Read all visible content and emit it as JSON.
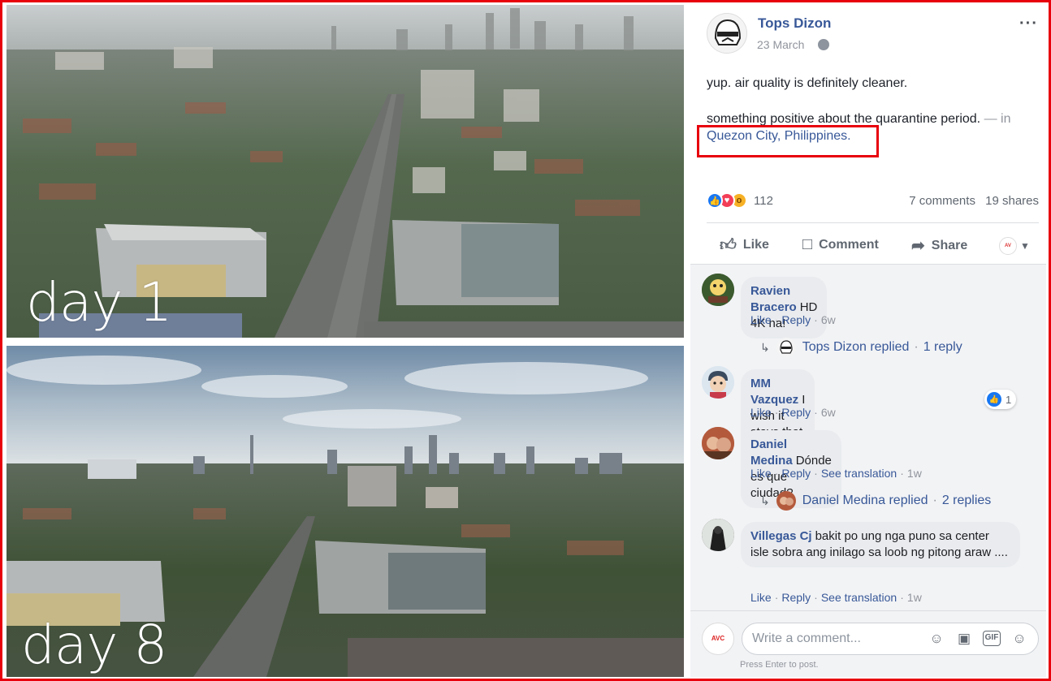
{
  "photos": {
    "top_caption": "day 1",
    "bottom_caption": "day 8"
  },
  "post": {
    "author": "Tops Dizon",
    "date": "23 March",
    "more_icon": "···",
    "line1": "yup. air quality is definitely cleaner.",
    "line2": "something positive about the quarantine period.",
    "location_prefix": "— in",
    "location": "Quezon City, Philippines.",
    "reaction_count": "112",
    "comments_count": "7 comments",
    "shares_count": "19 shares",
    "actions": {
      "like": "Like",
      "comment": "Comment",
      "share": "Share"
    }
  },
  "comments": [
    {
      "name": "Ravien Bracero",
      "text": "HD 4K na!",
      "like": "Like",
      "reply": "Reply",
      "time": "6w",
      "replied_by": "Tops Dizon replied",
      "replies": "1 reply"
    },
    {
      "name": "MM Vazquez",
      "text": "I wish it stays that way forever",
      "like": "Like",
      "reply": "Reply",
      "time": "6w",
      "like_count": "1"
    },
    {
      "name": "Daniel Medina",
      "text": "Dónde es que ciudad?",
      "like": "Like",
      "reply": "Reply",
      "translate": "See translation",
      "time": "1w",
      "replied_by": "Daniel Medina replied",
      "replies": "2 replies"
    },
    {
      "name": "Villegas Cj",
      "text": "bakit po ung nga puno sa center isle sobra ang inilago sa loob ng pitong araw ....",
      "like": "Like",
      "reply": "Reply",
      "translate": "See translation",
      "time": "1w"
    }
  ],
  "composer": {
    "placeholder": "Write a comment...",
    "hint": "Press Enter to post.",
    "gif_label": "GIF"
  },
  "colors": {
    "link": "#385898",
    "highlight_border": "#e8000d",
    "like_blue": "#1877f2"
  }
}
